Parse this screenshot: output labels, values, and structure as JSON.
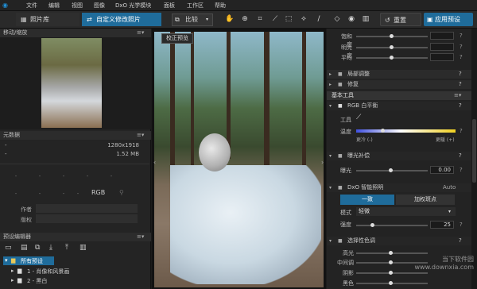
{
  "menubar": {
    "items": [
      "文件",
      "编辑",
      "视图",
      "图像",
      "DxO 光学模块",
      "面板",
      "工作区",
      "帮助"
    ]
  },
  "toolbar": {
    "tab_library": "照片库",
    "tab_customize": "自定义修改照片",
    "compare": "比较",
    "reset": "重置",
    "apply_preset": "应用预设"
  },
  "left": {
    "navigator_title": "移动/缩放",
    "metadata_title": "元数据",
    "dimensions": "1280x1918",
    "filesize": "1.52 MB",
    "rgb_label": "RGB",
    "author_label": "作者",
    "copyright_label": "版权",
    "preset_editor_title": "预设编辑器",
    "tree": [
      {
        "label": "所有预设",
        "selected": true
      },
      {
        "label": "1 - 肖像和风景画",
        "selected": false
      },
      {
        "label": "2 - 黑白",
        "selected": false
      }
    ],
    "dash": "-"
  },
  "viewer": {
    "tooltip": "校正预览"
  },
  "right": {
    "top_sliders": [
      "饱和度",
      "明亮度",
      "平均"
    ],
    "sec_local": "局部调整",
    "sec_repair": "修复",
    "tools_title": "基本工具",
    "wb_title": "RGB 白平衡",
    "tool_label": "工具",
    "temp_label": "温度",
    "cooler": "更冷 (-)",
    "warmer": "更暖 (+)",
    "exp_title": "曝光补偿",
    "exp_label": "曝光",
    "exp_value": "0.00",
    "smartlight_title": "DxO 智能照明",
    "smartlight_auto": "Auto",
    "tab_uniform": "一致",
    "tab_spot": "加权斑点",
    "mode_label": "模式",
    "mode_value": "轻微",
    "strength_label": "强度",
    "strength_value": "25",
    "selective_title": "选择性色调",
    "sel_sliders": [
      "高光",
      "中间调",
      "阴影",
      "黑色"
    ],
    "q": "?"
  },
  "watermark": {
    "line1": "当下软件园",
    "line2": "www.downxia.com"
  },
  "colors": {
    "accent": "#1f6c9b"
  }
}
